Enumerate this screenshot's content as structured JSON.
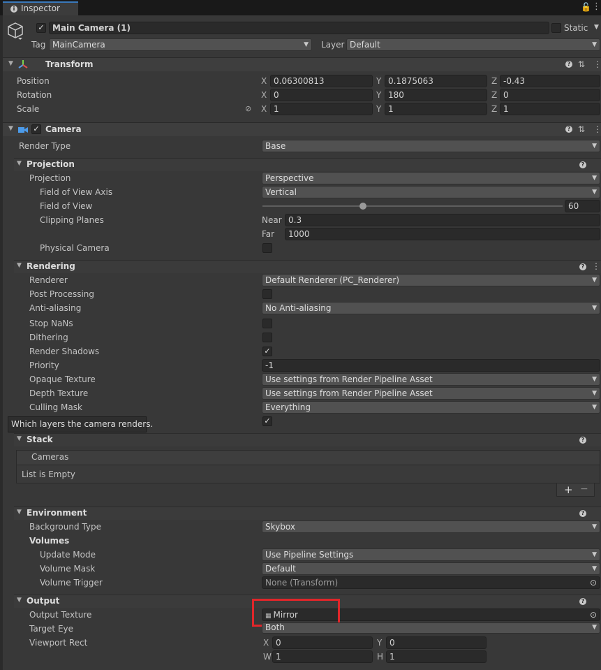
{
  "tab": {
    "title": "Inspector"
  },
  "object": {
    "name": "Main Camera (1)",
    "static_label": "Static",
    "tag_label": "Tag",
    "tag_value": "MainCamera",
    "layer_label": "Layer",
    "layer_value": "Default"
  },
  "transform": {
    "title": "Transform",
    "position_label": "Position",
    "rotation_label": "Rotation",
    "scale_label": "Scale",
    "position": {
      "x": "0.06300813",
      "y": "0.1875063",
      "z": "-0.43"
    },
    "rotation": {
      "x": "0",
      "y": "180",
      "z": "0"
    },
    "scale": {
      "x": "1",
      "y": "1",
      "z": "1"
    },
    "axis_x": "X",
    "axis_y": "Y",
    "axis_z": "Z"
  },
  "camera": {
    "title": "Camera",
    "render_type_label": "Render Type",
    "render_type_value": "Base"
  },
  "projection": {
    "title": "Projection",
    "projection_label": "Projection",
    "projection_value": "Perspective",
    "fov_axis_label": "Field of View Axis",
    "fov_axis_value": "Vertical",
    "fov_label": "Field of View",
    "fov_value": "60",
    "fov_slider_fraction": 0.334,
    "clipping_label": "Clipping Planes",
    "near_label": "Near",
    "near_value": "0.3",
    "far_label": "Far",
    "far_value": "1000",
    "physical_label": "Physical Camera"
  },
  "rendering": {
    "title": "Rendering",
    "renderer_label": "Renderer",
    "renderer_value": "Default Renderer (PC_Renderer)",
    "post_label": "Post Processing",
    "aa_label": "Anti-aliasing",
    "aa_value": "No Anti-aliasing",
    "stopnans_label": "Stop NaNs",
    "dither_label": "Dithering",
    "shadows_label": "Render Shadows",
    "priority_label": "Priority",
    "priority_value": "-1",
    "opaque_label": "Opaque Texture",
    "opaque_value": "Use settings from Render Pipeline Asset",
    "depth_label": "Depth Texture",
    "depth_value": "Use settings from Render Pipeline Asset",
    "culling_label": "Culling Mask",
    "culling_value": "Everything",
    "tooltip": "Which layers the camera renders."
  },
  "stack": {
    "title": "Stack",
    "cameras_header": "Cameras",
    "empty_text": "List is Empty",
    "add_label": "+",
    "remove_label": "−"
  },
  "environment": {
    "title": "Environment",
    "bg_label": "Background Type",
    "bg_value": "Skybox",
    "volumes_label": "Volumes",
    "update_label": "Update Mode",
    "update_value": "Use Pipeline Settings",
    "mask_label": "Volume Mask",
    "mask_value": "Default",
    "trigger_label": "Volume Trigger",
    "trigger_value": "None (Transform)"
  },
  "output": {
    "title": "Output",
    "texture_label": "Output Texture",
    "texture_value": "Mirror",
    "eye_label": "Target Eye",
    "eye_value": "Both",
    "viewport_label": "Viewport Rect",
    "vx": "0",
    "vy": "0",
    "vw": "1",
    "vh": "1",
    "axis_w": "W",
    "axis_h": "H"
  },
  "colors": {
    "accent": "#3a79bb",
    "highlight": "#e0262a"
  }
}
